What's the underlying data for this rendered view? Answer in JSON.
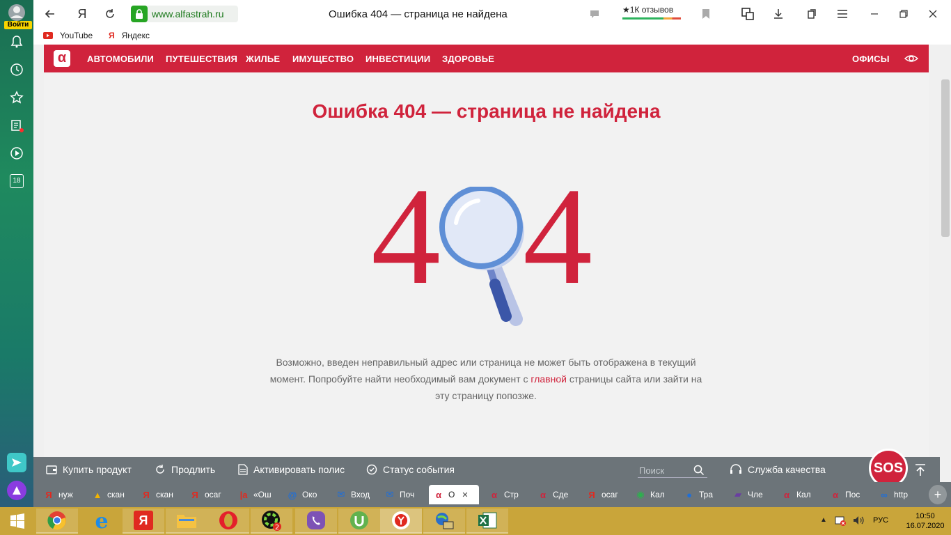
{
  "sidebar": {
    "login_label": "Войти",
    "notifications_badge": "18"
  },
  "browser": {
    "url": "www.alfastrah.ru",
    "page_title": "Ошибка 404 — страница не найдена",
    "reviews": "★1К отзывов",
    "bookmarks": [
      {
        "label": "YouTube"
      },
      {
        "label": "Яндекс"
      }
    ]
  },
  "site_nav": {
    "logo": "α",
    "items": [
      "АВТОМОБИЛИ",
      "ПУТЕШЕСТВИЯ",
      "ЖИЛЬЕ",
      "ИМУЩЕСТВО",
      "ИНВЕСТИЦИИ",
      "ЗДОРОВЬЕ"
    ],
    "offices": "ОФИСЫ"
  },
  "content": {
    "title": "Ошибка 404 — страница не найдена",
    "digit_left": "4",
    "digit_right": "4",
    "text_before": "Возможно, введен неправильный адрес или страница не может быть отображена в текущий момент. Попробуйте найти необходимый вам документ с ",
    "link": "главной",
    "text_after": " страницы сайта или зайти на эту страницу попозже."
  },
  "bottom_bar": {
    "buy": "Купить продукт",
    "renew": "Продлить",
    "activate": "Активировать полис",
    "status": "Статус события",
    "search_placeholder": "Поиск",
    "quality": "Служба качества",
    "sos": "SOS"
  },
  "tabs": [
    {
      "fav": "Я",
      "label": "нуж",
      "color": "#e02a20"
    },
    {
      "fav": "▲",
      "label": "скан",
      "color": "#f3b400"
    },
    {
      "fav": "Я",
      "label": "скан",
      "color": "#e02a20"
    },
    {
      "fav": "Я",
      "label": "осаг",
      "color": "#e02a20"
    },
    {
      "fav": "|a",
      "label": "«Ош",
      "color": "#e02a20"
    },
    {
      "fav": "@",
      "label": "Око",
      "color": "#1e6fd9"
    },
    {
      "fav": "✉",
      "label": "Вход",
      "color": "#1e6fd9"
    },
    {
      "fav": "✉",
      "label": "Поч",
      "color": "#1e6fd9"
    },
    {
      "fav": "α",
      "label": "О",
      "color": "#d0233c",
      "active": true
    },
    {
      "fav": "α",
      "label": "Стр",
      "color": "#d0233c"
    },
    {
      "fav": "α",
      "label": "Сде",
      "color": "#d0233c"
    },
    {
      "fav": "Я",
      "label": "осаг",
      "color": "#e02a20"
    },
    {
      "fav": "◉",
      "label": "Кал",
      "color": "#2bb24c"
    },
    {
      "fav": "●",
      "label": "Тра",
      "color": "#1e6fd9"
    },
    {
      "fav": "▰",
      "label": "Чле",
      "color": "#6a3ea1"
    },
    {
      "fav": "α",
      "label": "Кал",
      "color": "#d0233c"
    },
    {
      "fav": "α",
      "label": "Пос",
      "color": "#d0233c"
    },
    {
      "fav": "∞",
      "label": "http",
      "color": "#1e6fd9"
    }
  ],
  "taskbar": {
    "lang": "РУС",
    "time": "10:50",
    "date": "16.07.2020",
    "viber_badge": "2"
  }
}
